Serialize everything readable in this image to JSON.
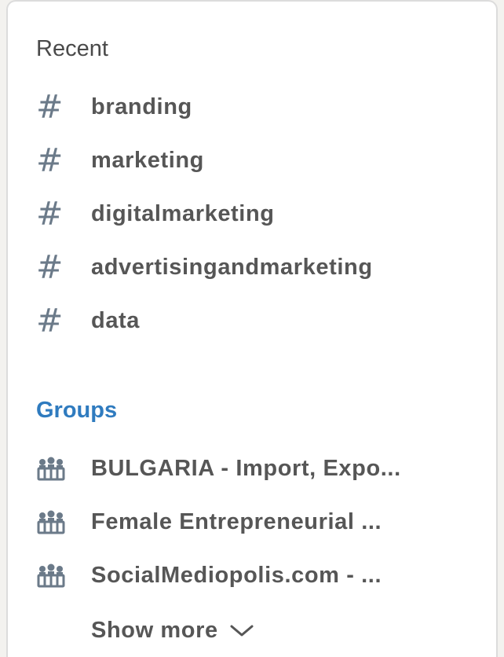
{
  "recent": {
    "heading": "Recent",
    "items": [
      {
        "icon": "hashtag-icon",
        "label": "branding"
      },
      {
        "icon": "hashtag-icon",
        "label": "marketing"
      },
      {
        "icon": "hashtag-icon",
        "label": "digitalmarketing"
      },
      {
        "icon": "hashtag-icon",
        "label": "advertisingandmarketing"
      },
      {
        "icon": "hashtag-icon",
        "label": "data"
      }
    ]
  },
  "groups": {
    "heading": "Groups",
    "items": [
      {
        "icon": "group-icon",
        "label": "BULGARIA - Import, Expo..."
      },
      {
        "icon": "group-icon",
        "label": "Female Entrepreneurial ..."
      },
      {
        "icon": "group-icon",
        "label": "SocialMediopolis.com - ..."
      }
    ],
    "show_more_label": "Show more",
    "show_more_icon": "chevron-down-icon"
  },
  "colors": {
    "heading_text": "#4a4a4a",
    "groups_heading": "#2f7bbf",
    "item_text": "#565656",
    "icon": "#6b7a89"
  }
}
